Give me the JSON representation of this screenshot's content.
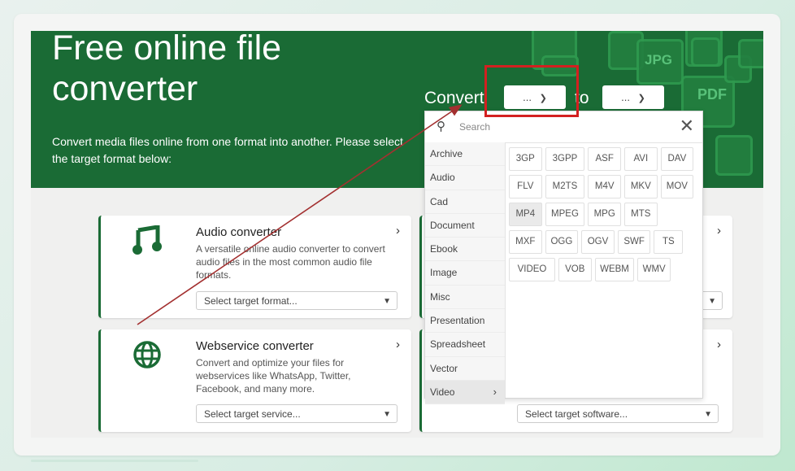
{
  "hero": {
    "title": "Free online file converter",
    "subtitle": "Convert media files online from one format into another. Please select the target format below:",
    "convert_label": "Convert",
    "to_label": "to",
    "from_button": "...",
    "to_button": "...",
    "deco_labels": [
      "JPG",
      "PDF"
    ]
  },
  "dropdown": {
    "search_placeholder": "Search",
    "categories": [
      "Archive",
      "Audio",
      "Cad",
      "Document",
      "Ebook",
      "Image",
      "Misc",
      "Presentation",
      "Spreadsheet",
      "Vector",
      "Video"
    ],
    "active_category": "Video",
    "formats": [
      "3GP",
      "3GPP",
      "ASF",
      "AVI",
      "DAV",
      "FLV",
      "M2TS",
      "M4V",
      "MKV",
      "MOV",
      "MP4",
      "MPEG",
      "MPG",
      "MTS",
      "MXF",
      "OGG",
      "OGV",
      "SWF",
      "TS",
      "VIDEO",
      "VOB",
      "WEBM",
      "WMV"
    ],
    "highlighted_format": "MP4"
  },
  "tiles": {
    "audio": {
      "title": "Audio converter",
      "desc": "A versatile online audio converter to convert audio files in the most common audio file formats.",
      "select": "Select target format..."
    },
    "webservice": {
      "title": "Webservice converter",
      "desc": "Convert and optimize your files for webservices like WhatsApp, Twitter, Facebook, and many more.",
      "select": "Select target service..."
    },
    "right_bottom": {
      "select": "Select target software..."
    }
  },
  "colors": {
    "brand_green": "#1a6b35",
    "highlight_red": "#d32020",
    "arrow": "#a33030"
  }
}
